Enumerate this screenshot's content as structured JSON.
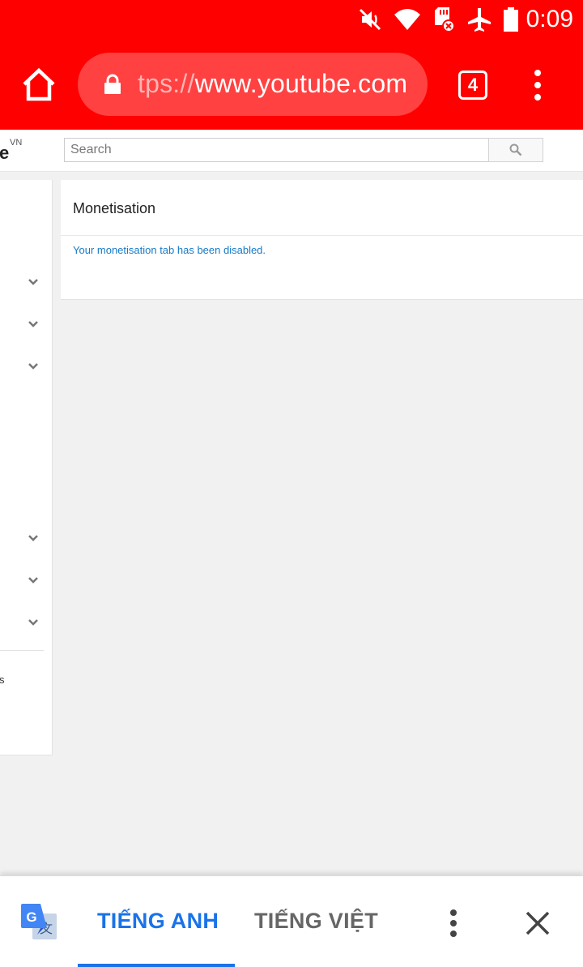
{
  "status_bar": {
    "time": "0:09",
    "icons": [
      "mute-icon",
      "wifi-icon",
      "sd-card-error-icon",
      "airplane-mode-icon",
      "battery-icon"
    ]
  },
  "browser": {
    "url_scheme": "tps://",
    "url_host": "www.youtube.com",
    "tab_count": "4",
    "icons": [
      "home-icon",
      "lock-icon",
      "more-vert-icon"
    ],
    "accent": "#ff0000"
  },
  "youtube": {
    "logo_fragment": "e",
    "region": "VN",
    "search_placeholder": "Search",
    "search_icon": "search-icon"
  },
  "left_nav": {
    "text_fragment": "s",
    "expanders": [
      "chevron-down-icon",
      "chevron-down-icon",
      "chevron-down-icon",
      "chevron-down-icon",
      "chevron-down-icon",
      "chevron-down-icon"
    ]
  },
  "main": {
    "title": "Monetisation",
    "message": "Your monetisation tab has been disabled."
  },
  "translate_bar": {
    "source_lang": "TIẾNG ANH",
    "target_lang": "TIẾNG VIỆT",
    "selected": "source",
    "accent": "#1a73e8",
    "icons": [
      "google-translate-icon",
      "more-vert-icon",
      "close-icon"
    ]
  }
}
